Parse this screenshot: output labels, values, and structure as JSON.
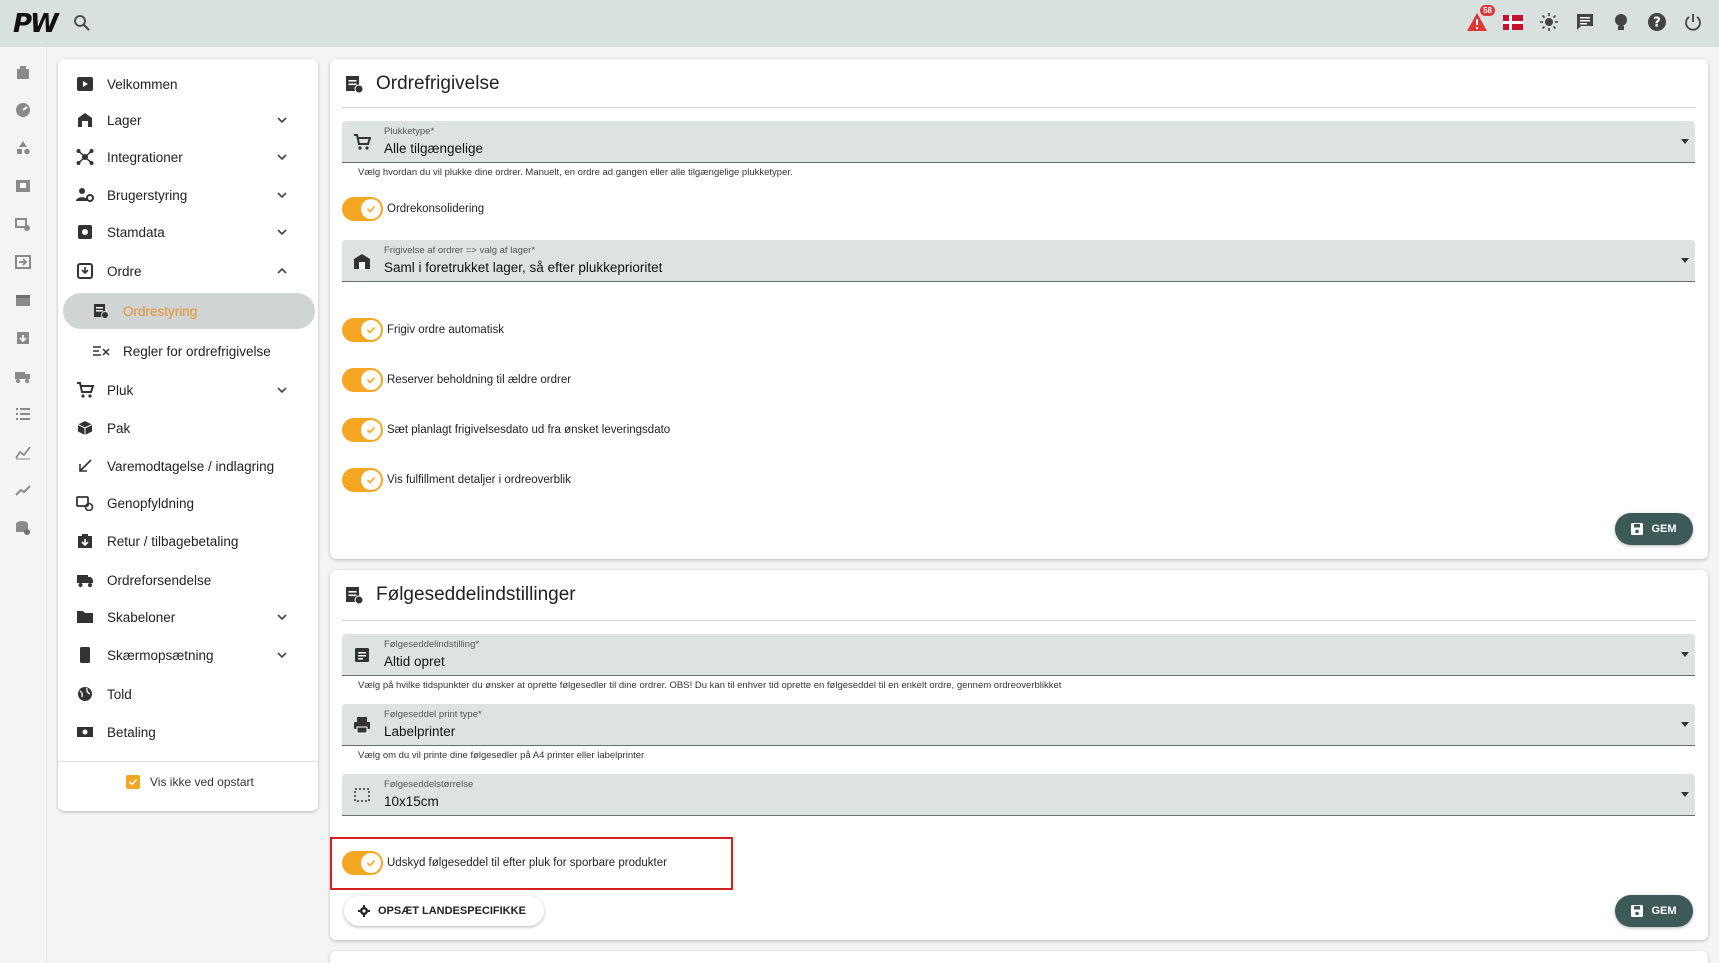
{
  "topbar": {
    "logo": "PW",
    "alert_count": "58"
  },
  "colors": {
    "accent": "#f5a623",
    "primary": "#3d5a58",
    "highlight": "#d02020"
  },
  "sidebar": {
    "items": [
      {
        "label": "Velkommen",
        "icon": "play-icon"
      },
      {
        "label": "Lager",
        "icon": "warehouse-icon"
      },
      {
        "label": "Integrationer",
        "icon": "hub-icon"
      },
      {
        "label": "Brugerstyring",
        "icon": "users-gear-icon"
      },
      {
        "label": "Stamdata",
        "icon": "database-icon"
      },
      {
        "label": "Ordre",
        "icon": "order-icon"
      },
      {
        "label": "Ordrestyring",
        "icon": "order-settings-icon"
      },
      {
        "label": "Regler for ordrefrigivelse",
        "icon": "rules-icon"
      },
      {
        "label": "Pluk",
        "icon": "cart-icon"
      },
      {
        "label": "Pak",
        "icon": "package-icon"
      },
      {
        "label": "Varemodtagelse / indlagring",
        "icon": "arrow-down-left-icon"
      },
      {
        "label": "Genopfyldning",
        "icon": "replenish-icon"
      },
      {
        "label": "Retur / tilbagebetaling",
        "icon": "return-icon"
      },
      {
        "label": "Ordreforsendelse",
        "icon": "truck-icon"
      },
      {
        "label": "Skabeloner",
        "icon": "folder-icon"
      },
      {
        "label": "Skærmopsætning",
        "icon": "phone-icon"
      },
      {
        "label": "Told",
        "icon": "globe-icon"
      },
      {
        "label": "Betaling",
        "icon": "cash-icon"
      }
    ],
    "startup_label": "Vis ikke ved opstart"
  },
  "release_card": {
    "title": "Ordrefrigivelse",
    "pick_type": {
      "label": "Plukketype*",
      "value": "Alle tilgængelige",
      "hint": "Vælg hvordan du vil plukke dine ordrer. Manuelt, en ordre ad gangen eller alle tilgængelige plukketyper."
    },
    "consolidation_label": "Ordrekonsolidering",
    "release_choice": {
      "label": "Frigivelse af ordrer => valg af lager*",
      "value": "Saml i foretrukket lager, så efter plukkeprioritet"
    },
    "auto_release_label": "Frigiv ordre automatisk",
    "reserve_label": "Reserver beholdning til ældre ordrer",
    "planned_date_label": "Sæt planlagt frigivelsesdato ud fra ønsket leveringsdato",
    "fulfillment_label": "Vis fulfillment detaljer i ordreoverblik",
    "save_label": "GEM"
  },
  "slip_card": {
    "title": "Følgeseddelindstillinger",
    "setting": {
      "label": "Følgeseddelindstilling*",
      "value": "Altid opret",
      "hint": "Vælg på hvilke tidspunkter du ønsker at oprette følgesedler til dine ordrer. OBS! Du kan til enhver tid oprette en følgeseddel til en enkelt ordre, gennem ordreoverblikket"
    },
    "print_type": {
      "label": "Følgeseddel print type*",
      "value": "Labelprinter",
      "hint": "Vælg om du vil printe dine følgesedler på A4 printer eller labelprinter"
    },
    "size": {
      "label": "Følgeseddelstørrelse",
      "value": "10x15cm"
    },
    "postpone_label": "Udskyd følgeseddel til efter pluk for sporbare produkter",
    "country_button_label": "OPSÆT LANDESPECIFIKKE",
    "save_label": "GEM"
  }
}
